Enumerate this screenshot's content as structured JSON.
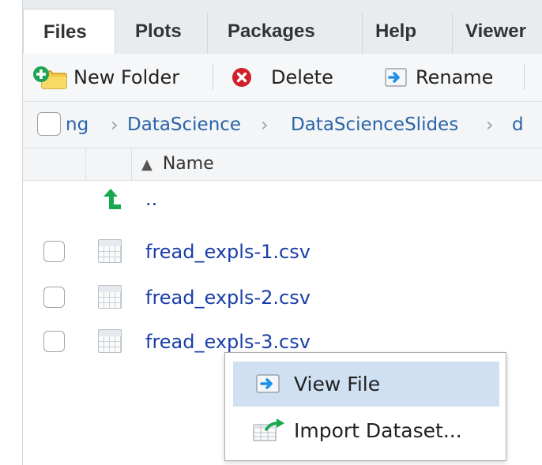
{
  "tabs": [
    {
      "label": "Files"
    },
    {
      "label": "Plots"
    },
    {
      "label": "Packages"
    },
    {
      "label": "Help"
    },
    {
      "label": "Viewer"
    }
  ],
  "toolbar": {
    "new_folder_label": "New Folder",
    "delete_label": "Delete",
    "rename_label": "Rename"
  },
  "breadcrumb": {
    "items": [
      "ng",
      "DataScience",
      "DataScienceSlides",
      "d"
    ]
  },
  "columns": {
    "name_label": "Name",
    "sort_indicator": "▲"
  },
  "files": {
    "parent": "..",
    "rows": [
      {
        "name": "fread_expls-1.csv"
      },
      {
        "name": "fread_expls-2.csv"
      },
      {
        "name": "fread_expls-3.csv"
      }
    ]
  },
  "context_menu": {
    "items": [
      {
        "label": "View File"
      },
      {
        "label": "Import Dataset..."
      }
    ]
  },
  "icons": {
    "new_folder": "new-folder-icon",
    "delete": "delete-icon",
    "rename": "rename-icon",
    "up": "up-arrow-icon",
    "csv": "csv-file-icon",
    "view": "view-file-icon",
    "import": "import-dataset-icon"
  },
  "colors": {
    "link": "#1a3ea8",
    "breadcrumb": "#2a64a8",
    "menu_highlight": "#cfe0f2",
    "delete_red": "#d0202a",
    "up_arrow_green": "#17a84f"
  }
}
